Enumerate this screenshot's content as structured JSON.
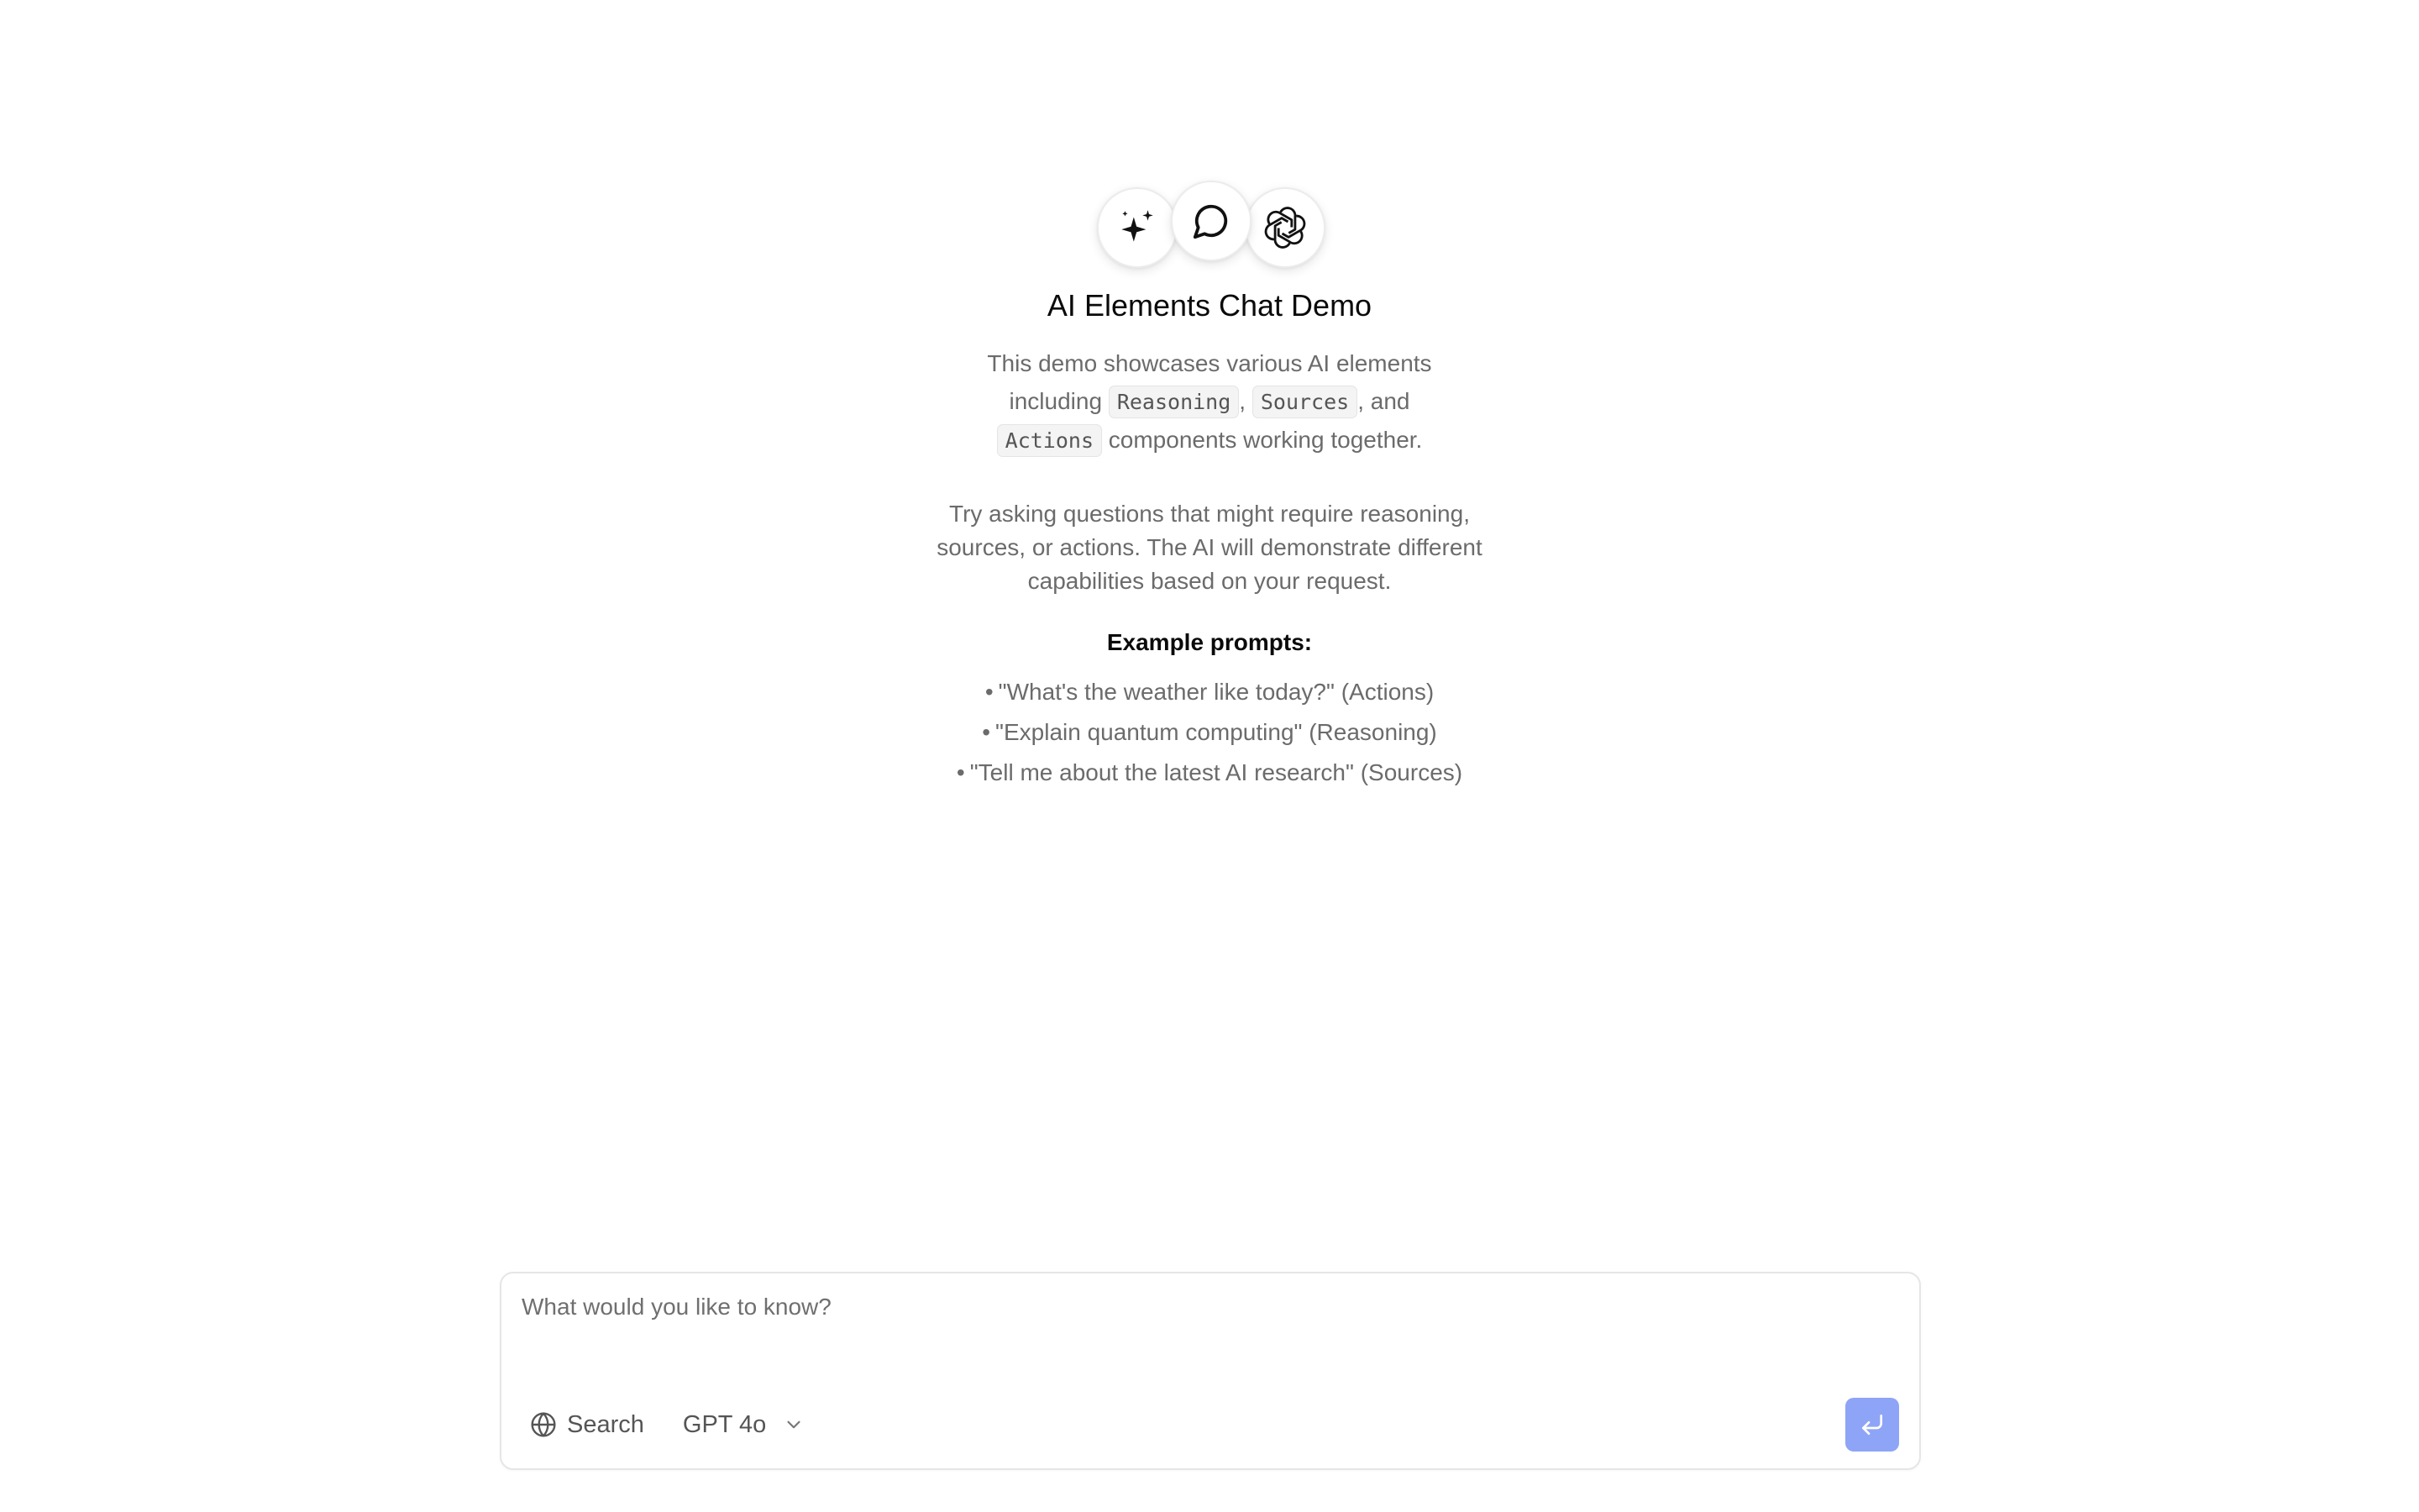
{
  "hero": {
    "icons": [
      "sparkles-icon",
      "message-circle-icon",
      "openai-logo-icon"
    ],
    "title": "AI Elements Chat Demo",
    "intro": {
      "line1": "This demo showcases various AI elements",
      "including": "including",
      "code1": "Reasoning",
      "comma": ",",
      "code2": "Sources",
      "and": ", and",
      "code3": "Actions",
      "tail": "components working together."
    },
    "try_text": "Try asking questions that might require reasoning, sources, or actions. The AI will demonstrate different capabilities based on your request.",
    "examples_title": "Example prompts:",
    "examples": [
      "\"What's the weather like today?\" (Actions)",
      "\"Explain quantum computing\" (Reasoning)",
      "\"Tell me about the latest AI research\" (Sources)"
    ],
    "bullet": "•"
  },
  "composer": {
    "placeholder": "What would you like to know?",
    "value": "",
    "search_label": "Search",
    "model_selected": "GPT 4o",
    "send_icon": "corner-down-left-icon",
    "accent": "#8ea4f6"
  }
}
